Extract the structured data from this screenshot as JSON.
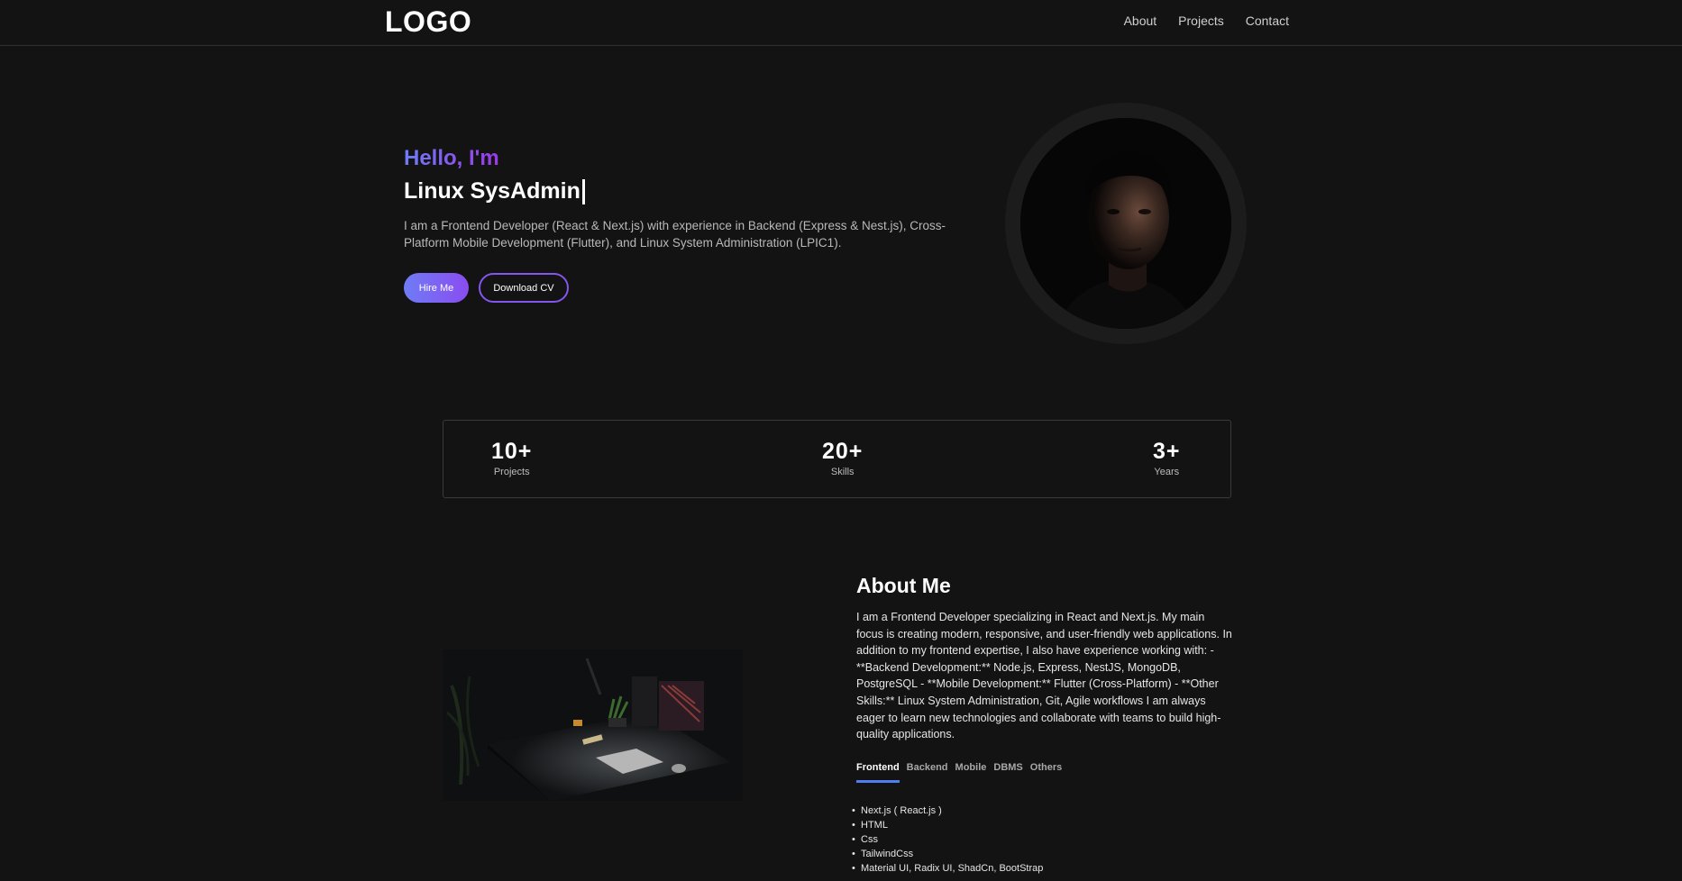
{
  "nav": {
    "logo": "LOGO",
    "links": [
      "About",
      "Projects",
      "Contact"
    ]
  },
  "hero": {
    "greeting": "Hello, I'm",
    "role": "Linux SysAdmin",
    "description": "I am a Frontend Developer (React & Next.js) with experience in Backend (Express & Nest.js), Cross-Platform Mobile Development (Flutter), and Linux System Administration (LPIC1).",
    "hire_label": "Hire Me",
    "cv_label": "Download CV"
  },
  "stats": [
    {
      "value": "10+",
      "label": "Projects"
    },
    {
      "value": "20+",
      "label": "Skills"
    },
    {
      "value": "3+",
      "label": "Years"
    }
  ],
  "about": {
    "title": "About Me",
    "text": "I am a Frontend Developer specializing in React and Next.js. My main focus is creating modern, responsive, and user-friendly web applications. In addition to my frontend expertise, I also have experience working with: - **Backend Development:** Node.js, Express, NestJS, MongoDB, PostgreSQL - **Mobile Development:** Flutter (Cross-Platform) - **Other Skills:** Linux System Administration, Git, Agile workflows I am always eager to learn new technologies and collaborate with teams to build high-quality applications.",
    "tabs": [
      "Frontend",
      "Backend",
      "Mobile",
      "DBMS",
      "Others"
    ],
    "active_tab": "Frontend",
    "skills": [
      "Next.js ( React.js )",
      "HTML",
      "Css",
      "TailwindCss",
      "Material UI, Radix UI, ShadCn, BootStrap"
    ]
  },
  "colors": {
    "background": "#131313",
    "accent_start": "#6f7cf6",
    "accent_end": "#9b39e8",
    "tab_underline": "#4f7ef0"
  }
}
